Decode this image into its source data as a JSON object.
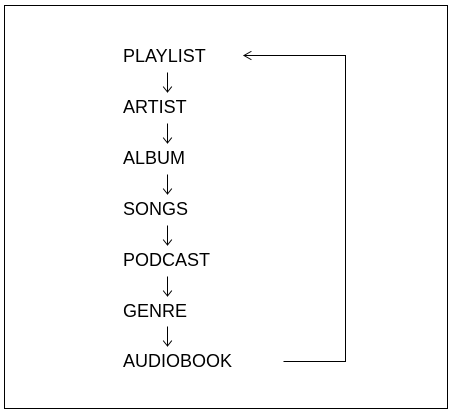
{
  "diagram": {
    "nodes": [
      {
        "id": "playlist",
        "label": "PLAYLIST"
      },
      {
        "id": "artist",
        "label": "ARTIST"
      },
      {
        "id": "album",
        "label": "ALBUM"
      },
      {
        "id": "songs",
        "label": "SONGS"
      },
      {
        "id": "podcast",
        "label": "PODCAST"
      },
      {
        "id": "genre",
        "label": "GENRE"
      },
      {
        "id": "audiobook",
        "label": "AUDIOBOOK"
      }
    ],
    "edges": [
      {
        "from": "playlist",
        "to": "artist"
      },
      {
        "from": "artist",
        "to": "album"
      },
      {
        "from": "album",
        "to": "songs"
      },
      {
        "from": "songs",
        "to": "podcast"
      },
      {
        "from": "podcast",
        "to": "genre"
      },
      {
        "from": "genre",
        "to": "audiobook"
      },
      {
        "from": "audiobook",
        "to": "playlist"
      }
    ],
    "colors": {
      "line": "#000000",
      "text": "#000000",
      "background": "#ffffff"
    }
  }
}
